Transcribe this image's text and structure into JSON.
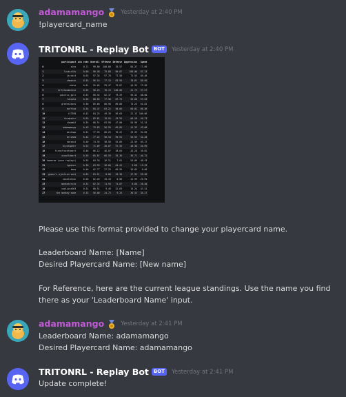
{
  "messages": [
    {
      "username": "adamamango",
      "timestamp": "Yesterday at 2:40 PM",
      "lines": [
        "!playercard_name"
      ]
    },
    {
      "username": "TRITONRL - Replay Bot",
      "bot_badge": "BOT",
      "timestamp": "Yesterday at 2:40 PM",
      "lines": [
        "Please use this format provided to change your playercard name.",
        "Leaderboard Name: [Name]",
        "Desired Playercard Name: [New name]",
        "For Reference, here are the current league standings. Use the name you find",
        "there as your 'Leaderboard Name' input."
      ]
    },
    {
      "username": "adamamango",
      "timestamp": "Yesterday at 2:41 PM",
      "lines": [
        "Leaderboard Name: adamamango",
        "Desired Playercard Name: adamamango"
      ]
    },
    {
      "username": "TRITONRL - Replay Bot",
      "bot_badge": "BOT",
      "timestamp": "Yesterday at 2:41 PM",
      "lines": [
        "Update complete!"
      ]
    }
  ],
  "standings": {
    "headers": [
      "",
      "participant",
      "win rate",
      "Overall",
      "Offense",
      "Defense",
      "Aggression",
      "Speed"
    ],
    "rows": [
      [
        "0",
        "alex",
        "0.71",
        "99.00",
        "100.00",
        "78.57",
        "84.37",
        "77.09"
      ],
      [
        "1",
        "lockscl0s",
        "0.60",
        "98.48",
        "75.88",
        "90.87",
        "100.00",
        "87.23"
      ],
      [
        "2",
        "[a mist",
        "0.63",
        "97.34",
        "97.78",
        "77.58",
        "72.55",
        "85.48"
      ],
      [
        "3",
        "zhmarch",
        "0.55",
        "96.16",
        "77.13",
        "63.99",
        "78.81",
        "85.05"
      ],
      [
        "4",
        "chevo",
        "0.61",
        "95.05",
        "93.47",
        "79.87",
        "44.35",
        "72.58"
      ],
      [
        "5",
        "lefttheobaldie",
        "0.55",
        "90.23",
        "78.13",
        "100.00",
        "41.73",
        "97.57"
      ],
      [
        "6",
        "pacific_gull",
        "0.52",
        "89.34",
        "82.37",
        "79.29",
        "56.32",
        "68.00"
      ],
      [
        "7",
        "luksika",
        "0.56",
        "88.83",
        "77.58",
        "87.75",
        "55.60",
        "57.63"
      ],
      [
        "8",
        "greenslaves",
        "0.50",
        "85.66",
        "80.98",
        "89.08",
        "74.25",
        "61.02"
      ],
      [
        "9",
        "duffled",
        "0.55",
        "85.47",
        "63.22",
        "58.66",
        "60.02",
        "66.36"
      ],
      [
        "10",
        "r27398",
        "0.42",
        "84.25",
        "49.39",
        "56.63",
        "21.13",
        "100.00"
      ],
      [
        "11",
        "ferdestor",
        "0.63",
        "83.01",
        "78.55",
        "43.53",
        "66.28",
        "49.73"
      ],
      [
        "12",
        "chodak3",
        "0.55",
        "80.51",
        "63.98",
        "47.00",
        "54.90",
        "51.24"
      ],
      [
        "13",
        "adamamango",
        "0.49",
        "79.83",
        "56.99",
        "69.85",
        "41.33",
        "43.08"
      ],
      [
        "14",
        "mintmap",
        "0.51",
        "77.33",
        "66.25",
        "76.22",
        "23.53",
        "52.05"
      ],
      [
        "15",
        "bricham",
        "0.42",
        "77.22",
        "56.54",
        "59.91",
        "54.93",
        "52.28"
      ],
      [
        "16",
        "hotshot",
        "0.40",
        "74.35",
        "38.58",
        "52.66",
        "22.59",
        "63.17"
      ],
      [
        "17",
        "krystopher",
        "0.53",
        "71.09",
        "28.07",
        "57.35",
        "38.38",
        "54.69"
      ],
      [
        "18",
        "fireofrochtheart",
        "0.46",
        "66.12",
        "46.07",
        "28.64",
        "43.28",
        "35.62"
      ],
      [
        "19",
        "scoutlebert",
        "0.55",
        "65.07",
        "60.59",
        "35.36",
        "36.71",
        "44.72"
      ],
      [
        "20",
        "kameroo (save replays)",
        "0.55",
        "64.26",
        "16.21",
        "7.61",
        "54.00",
        "46.43"
      ],
      [
        "21",
        "tgainer",
        "0.38",
        "63.59",
        "36.00",
        "64.41",
        "9.68",
        "13.25"
      ],
      [
        "22",
        "kaee",
        "0.46",
        "62.77",
        "27.23",
        "69.59",
        "36.85",
        "0.00"
      ],
      [
        "23",
        "goose's ejection seat",
        "0.63",
        "63.51",
        "0.00",
        "33.38",
        "37.92",
        "59.36"
      ],
      [
        "24",
        "noxolation",
        "0.50",
        "62.49",
        "45.44",
        "0.00",
        "41.99",
        "25.95"
      ],
      [
        "25",
        "monkestrulo",
        "0.31",
        "62.34",
        "11.94",
        "71.87",
        "0.00",
        "28.40"
      ],
      [
        "26",
        "coolzzzz363",
        "0.31",
        "60.51",
        "9.49",
        "22.63",
        "15.24",
        "47.51"
      ],
      [
        "27",
        "the monkey dude",
        "0.33",
        "50.00",
        "24.73",
        "9.25",
        "30.53",
        "34.27"
      ]
    ]
  }
}
